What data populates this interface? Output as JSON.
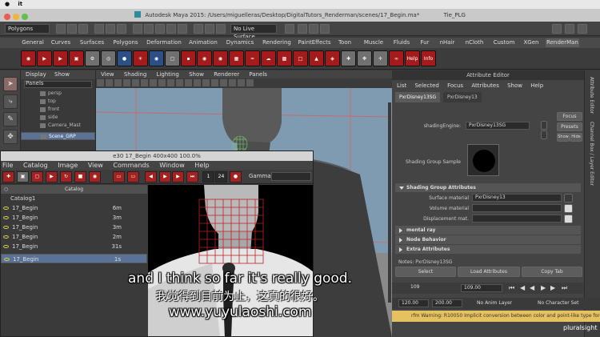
{
  "mac_menubar": {
    "apple": "",
    "app": "it"
  },
  "window": {
    "title": "Autodesk Maya 2015: /Users/miguelleras/Desktop/DigitalTutors_Renderman/scenes/17_Begin.ma*",
    "extra": "Tie_PLG"
  },
  "status_line": {
    "mode_select": "Polygons",
    "live_surface": "No Live Surface"
  },
  "shelf": {
    "tabs": [
      "General",
      "Curves",
      "Surfaces",
      "Polygons",
      "Deformation",
      "Animation",
      "Dynamics",
      "Rendering",
      "PaintEffects",
      "Toon",
      "Muscle",
      "Fluids",
      "Fur",
      "nHair",
      "nCloth",
      "Custom",
      "XGen",
      "RenderMan"
    ],
    "active_tab": "RenderMan",
    "help_label": "Help",
    "info_label": "Info"
  },
  "outliner": {
    "menu": [
      "Display",
      "Show",
      "Panels"
    ],
    "items": [
      "persp",
      "top",
      "front",
      "side",
      "Camera_Mast",
      "Scene_GRP"
    ]
  },
  "viewport": {
    "menu": [
      "View",
      "Shading",
      "Lighting",
      "Show",
      "Renderer",
      "Panels"
    ]
  },
  "render_window": {
    "title": "e30 17_Begin 400x400 100.0%",
    "menu": [
      "File",
      "Catalog",
      "Image",
      "View",
      "Commands",
      "Window",
      "Help"
    ],
    "frame": "1",
    "frame_end": "24",
    "gamma_label": "Gamma",
    "catalog_header": "Catalog",
    "catalog_root": "Catalog1",
    "catalog_items": [
      {
        "name": "17_Begin",
        "time": "6m"
      },
      {
        "name": "17_Begin",
        "time": "3m"
      },
      {
        "name": "17_Begin",
        "time": "3m"
      },
      {
        "name": "17_Begin",
        "time": "2m"
      },
      {
        "name": "17_Begin",
        "time": "31s"
      },
      {
        "name": "17_Begin",
        "time": "1s"
      }
    ]
  },
  "attribute_editor": {
    "title": "Attribute Editor",
    "menu": [
      "List",
      "Selected",
      "Focus",
      "Attributes",
      "Show",
      "Help"
    ],
    "tabs": [
      "PxrDisney13SG",
      "PxrDisney13"
    ],
    "shading_engine_label": "shadingEngine:",
    "shading_engine_value": "PxrDisney13SG",
    "focus_button": "Focus",
    "presets_button": "Presets",
    "show_button": "Show",
    "hide_button": "Hide",
    "sample_label": "Shading Group Sample",
    "sections": [
      "Shading Group Attributes",
      "mental ray",
      "Node Behavior",
      "Extra Attributes"
    ],
    "surface_material_label": "Surface material",
    "surface_material_value": "PxrDisney13",
    "volume_material_label": "Volume material",
    "displacement_label": "Displacement mat.",
    "notes_label": "Notes: PxrDisney13SG",
    "select_button": "Select",
    "load_attributes_button": "Load Attributes",
    "copy_tab_button": "Copy Tab",
    "side_tabs": [
      "Attribute Editor",
      "Channel Box / Layer Editor"
    ]
  },
  "timeline": {
    "current_frame": "109",
    "end_field": "109.00"
  },
  "range": {
    "start": "120.00",
    "end": "200.00",
    "anim_layer": "No Anim Layer",
    "char_set": "No Character Set"
  },
  "help_line": "rfm Warning: R10050 Implicit conversion between color and point-like type for inpu",
  "subtitles": {
    "english": "and I think so far it's really good.",
    "chinese": "我觉得到目前为止，这真的很好。",
    "url": "www.yuyulaoshi.com"
  },
  "watermark": "pluralsight"
}
